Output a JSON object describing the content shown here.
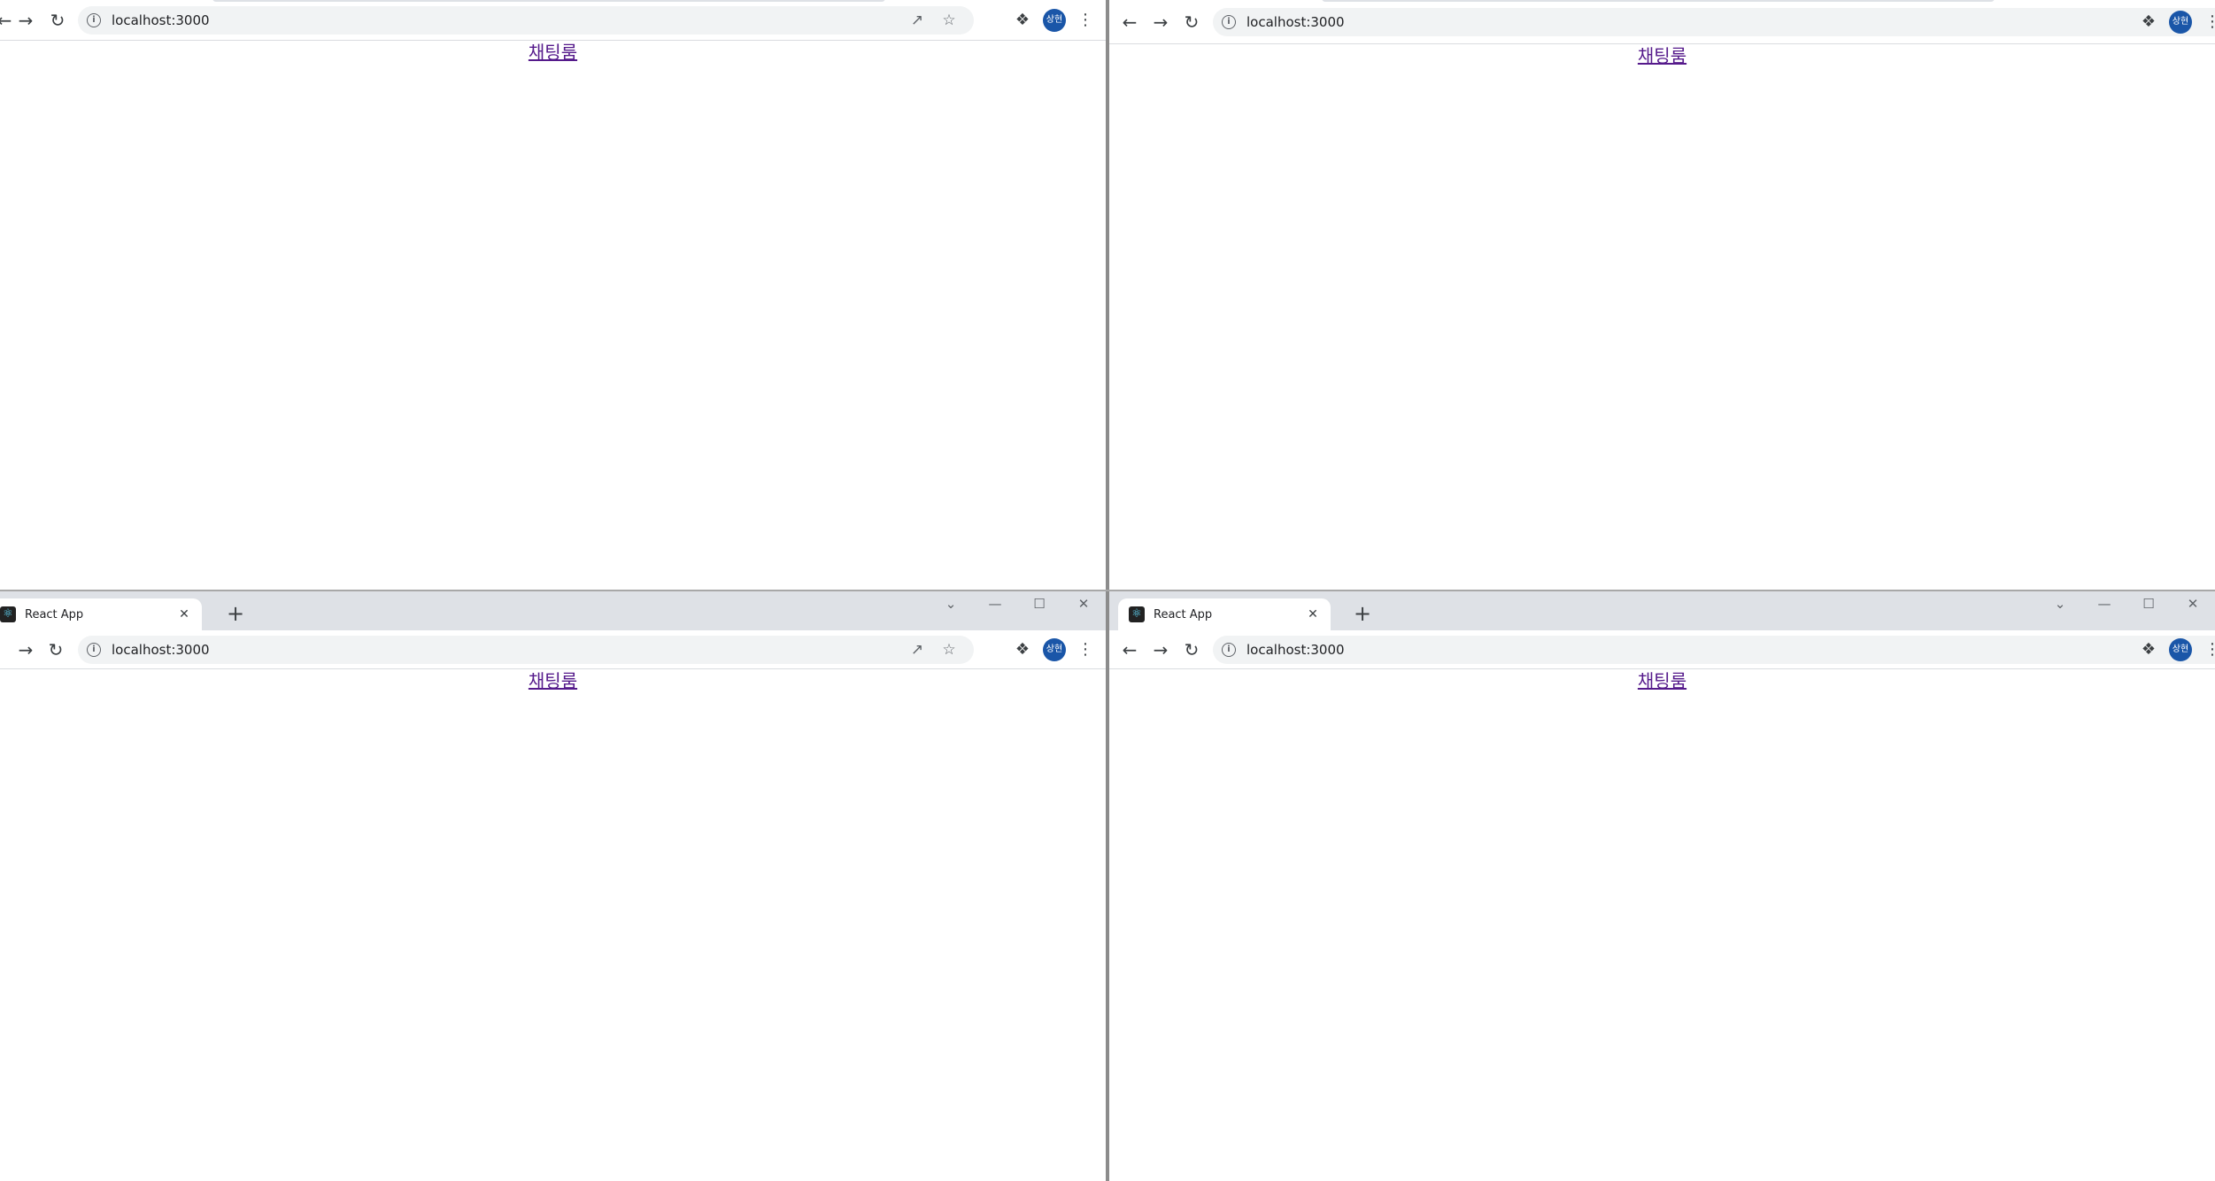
{
  "windows": [
    {
      "id": "top-left",
      "tab_title": "",
      "url": "localhost:3000",
      "avatar_text": "상현",
      "link_text": "채팅룸"
    },
    {
      "id": "top-right",
      "tab_title": "",
      "url": "localhost:3000",
      "avatar_text": "상현",
      "link_text": "채팅룸"
    },
    {
      "id": "bottom-left",
      "tab_title": "React App",
      "url": "localhost:3000",
      "avatar_text": "상현",
      "link_text": "채팅룸"
    },
    {
      "id": "bottom-right",
      "tab_title": "React App",
      "url": "localhost:3000",
      "avatar_text": "상현",
      "link_text": "채팅룸"
    }
  ],
  "icons": {
    "back": "arrow-left-icon",
    "forward": "arrow-right-icon",
    "reload": "reload-icon",
    "share": "share-icon",
    "bookmark": "star-icon",
    "extensions": "puzzle-icon",
    "menu": "kebab-menu-icon"
  },
  "colors": {
    "tabstrip": "#dee1e6",
    "omnibox": "#f1f3f4",
    "avatar": "#1a56a8",
    "visited_link": "#551a8b"
  }
}
